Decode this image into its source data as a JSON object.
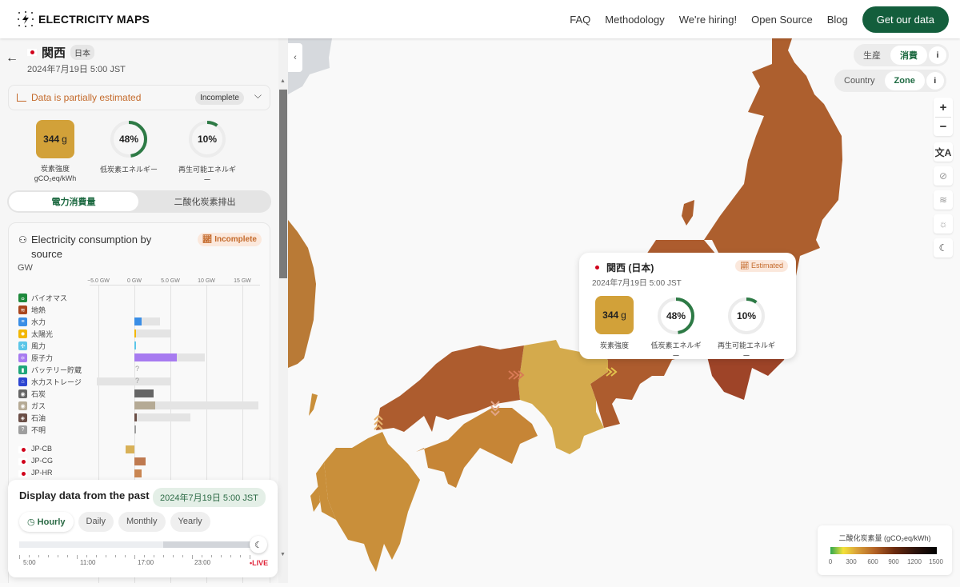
{
  "header": {
    "brand": "ELECTRICITY MAPS",
    "nav": [
      "FAQ",
      "Methodology",
      "We're hiring!",
      "Open Source",
      "Blog"
    ],
    "cta": "Get our data"
  },
  "zone": {
    "name": "関西",
    "country": "日本",
    "datetime": "2024年7月19日 5:00 JST",
    "estimation_notice": "Data is partially estimated",
    "estimation_badge": "Incomplete",
    "carbon_intensity": "344",
    "carbon_unit": "g",
    "carbon_label": "炭素強度",
    "carbon_unit_label": "gCO₂eq/kWh",
    "low_carbon_pct": 48,
    "low_carbon_label": "低炭素エネルギー",
    "renewable_pct": 10,
    "renewable_label": "再生可能エネルギー",
    "low_carbon_text": "48%",
    "renewable_text": "10%"
  },
  "segment": {
    "options": [
      "電力消費量",
      "二酸化炭素排出"
    ],
    "selected": "電力消費量"
  },
  "breakdown": {
    "title": "Electricity consumption by source",
    "badge": "Incomplete",
    "unit": "GW",
    "axis_ticks": [
      {
        "value": -5,
        "label": "−5.0 GW"
      },
      {
        "value": 0,
        "label": "0 GW"
      },
      {
        "value": 5,
        "label": "5.0 GW"
      },
      {
        "value": 10,
        "label": "10 GW"
      },
      {
        "value": 15,
        "label": "15 GW"
      }
    ],
    "sources": [
      {
        "label": "バイオマス",
        "icon": "leaf-icon",
        "color": "#1e8a3c",
        "value": 0,
        "capacity": 0
      },
      {
        "label": "地熱",
        "icon": "geothermal-icon",
        "color": "#a9461e",
        "value": 0,
        "capacity": 0
      },
      {
        "label": "水力",
        "icon": "hydro-icon",
        "color": "#3a8ee6",
        "value": 1.0,
        "capacity": 3.5
      },
      {
        "label": "太陽光",
        "icon": "sun-icon",
        "color": "#f2b705",
        "value": 0.1,
        "capacity": 5.0
      },
      {
        "label": "風力",
        "icon": "wind-icon",
        "color": "#5cc6e8",
        "value": 0.05,
        "capacity": 0
      },
      {
        "label": "原子力",
        "icon": "atom-icon",
        "color": "#a77bf0",
        "value": 5.9,
        "capacity": 9.8
      },
      {
        "label": "バッテリー貯蔵",
        "icon": "battery-icon",
        "color": "#1fa67a",
        "value": null,
        "capacity": 0,
        "unknown": true
      },
      {
        "label": "水力ストレージ",
        "icon": "storage-icon",
        "color": "#2d46d1",
        "value": null,
        "capacity_min": -5.2,
        "capacity": 5.1,
        "unknown": true
      },
      {
        "label": "石炭",
        "icon": "coal-icon",
        "color": "#666666",
        "value": 2.7,
        "capacity": 0
      },
      {
        "label": "ガス",
        "icon": "gas-icon",
        "color": "#b5aa95",
        "value": 2.9,
        "capacity": 17.2
      },
      {
        "label": "石油",
        "icon": "oil-icon",
        "color": "#6b4f47",
        "value": 0.3,
        "capacity": 7.8
      },
      {
        "label": "不明",
        "icon": "unknown-icon",
        "color": "#9e9e9e",
        "value": 0.1,
        "capacity": 0
      }
    ],
    "exchanges": [
      {
        "label": "JP-CB",
        "value": -1.2,
        "color": "#d8b158"
      },
      {
        "label": "JP-CG",
        "value": 1.5,
        "color": "#bf7a50"
      },
      {
        "label": "JP-HR",
        "value": 1.0,
        "color": "#c98652"
      }
    ]
  },
  "past": {
    "title": "Display data from the past",
    "selected_date": "2024年7月19日 5:00 JST",
    "tabs": [
      "Hourly",
      "Daily",
      "Monthly",
      "Yearly"
    ],
    "active_tab": "Hourly",
    "time_labels": [
      "5:00",
      "11:00",
      "17:00",
      "23:00"
    ],
    "live_label": "•LIVE",
    "slider_position": 1.0
  },
  "map_controls": {
    "mode_options": [
      "生産",
      "消費"
    ],
    "mode_selected": "消費",
    "level_options": [
      "Country",
      "Zone"
    ],
    "level_selected": "Zone",
    "info": "i",
    "zoom_in": "+",
    "zoom_out": "−"
  },
  "tooltip": {
    "title": "関西 (日本)",
    "badge": "Estimated",
    "datetime": "2024年7月19日 5:00 JST",
    "carbon_intensity": "344",
    "carbon_unit": "g",
    "carbon_label": "炭素強度",
    "low_carbon_text": "48%",
    "low_carbon_label": "低炭素エネルギー",
    "renewable_text": "10%",
    "renewable_label": "再生可能エネルギー"
  },
  "legend": {
    "title": "二酸化炭素量 (gCO₂eq/kWh)",
    "ticks": [
      "0",
      "300",
      "600",
      "900",
      "1200",
      "1500"
    ]
  },
  "colors": {
    "brand_green": "#135e3c",
    "estimated_orange": "#c46a2b",
    "kansai": "#d4aa4c",
    "chubu": "#ad5c2e",
    "chugoku": "#ad5c2e",
    "shikoku": "#c68536",
    "kyushu": "#c98f3a",
    "tohoku_tokyo": "#ad5f2e"
  }
}
